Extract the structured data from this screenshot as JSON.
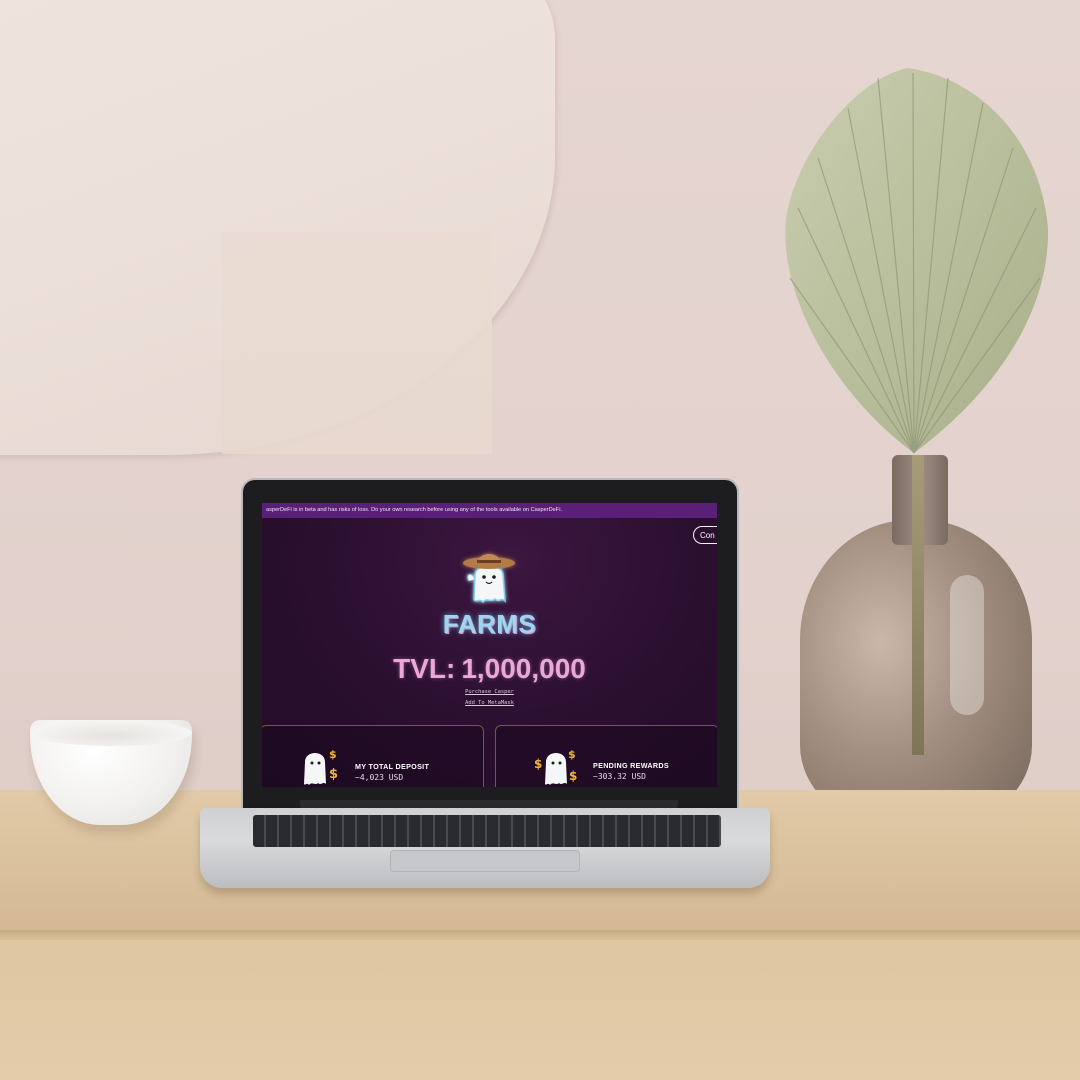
{
  "banner": {
    "text": "asperDeFi is in beta and has risks of loss. Do your own research before using any of the tools available on CasperDeFi."
  },
  "header": {
    "connect_label": "Con"
  },
  "hero": {
    "mascot_icon": "cowboy-ghost-icon",
    "title": "FARMS",
    "tvl_label": "TVL:",
    "tvl_value": "1,000,000"
  },
  "links": {
    "purchase": "Purchase Casper",
    "metamask": "Add To MetaMask"
  },
  "cards": {
    "deposit": {
      "title": "MY TOTAL DEPOSIT",
      "value": "~4,023 USD",
      "icon": "money-ghost-icon"
    },
    "rewards": {
      "title": "PENDING REWARDS",
      "value": "~303.32 USD",
      "icon": "money-ghost-icon"
    }
  },
  "colors": {
    "screen_bg": "#2a0f2f",
    "banner_bg": "#5a1f76",
    "tvl_pink": "#eaa8d7",
    "farms_blue": "#9fd6ee",
    "card_border": "#7a5a2e"
  }
}
